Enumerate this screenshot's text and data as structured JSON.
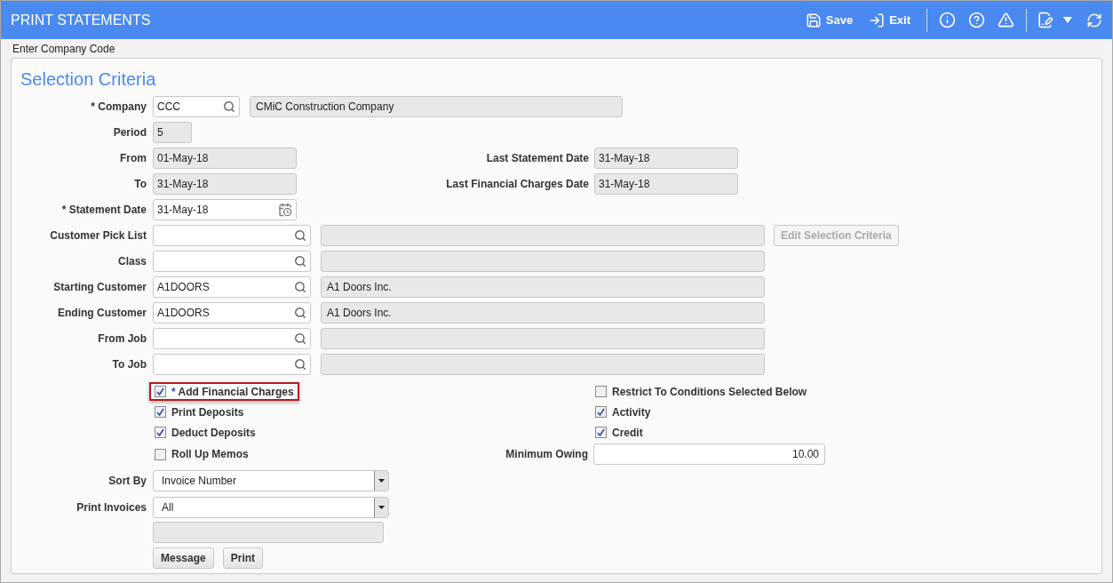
{
  "header": {
    "title": "PRINT STATEMENTS",
    "actions": [
      {
        "label": "Save",
        "kind": "save"
      },
      {
        "label": "Exit",
        "kind": "exit"
      }
    ]
  },
  "hint": "Enter Company Code",
  "section_title": "Selection Criteria",
  "rows": [
    {
      "label": "* Company",
      "field": {
        "kind": "code",
        "value": "CCC"
      },
      "description": "CMiC Construction Company"
    },
    {
      "label": "Period",
      "field": {
        "kind": "number",
        "value": "5"
      }
    },
    {
      "label": "From",
      "field": {
        "kind": "readonly",
        "value": "01-May-18"
      },
      "right": {
        "label": "Last Statement Date",
        "value": "31-May-18"
      }
    },
    {
      "label": "To",
      "field": {
        "kind": "readonly",
        "value": "31-May-18"
      },
      "right": {
        "label": "Last Financial Charges Date",
        "value": "31-May-18"
      }
    },
    {
      "label": "* Statement Date",
      "field": {
        "kind": "date",
        "value": "31-May-18"
      }
    },
    {
      "label": "Customer Pick List",
      "field": {
        "kind": "lookup"
      },
      "description": "",
      "button": {
        "label": "Edit Selection Criteria",
        "disabled": true
      }
    },
    {
      "label": "Class",
      "field": {
        "kind": "lookup"
      },
      "description": ""
    },
    {
      "label": "Starting Customer",
      "field": {
        "kind": "lookup",
        "value": "A1DOORS"
      },
      "description": "A1 Doors Inc."
    },
    {
      "label": "Ending Customer",
      "field": {
        "kind": "lookup",
        "value": "A1DOORS"
      },
      "description": "A1 Doors Inc."
    },
    {
      "label": "From Job",
      "field": {
        "kind": "lookup"
      },
      "description": ""
    },
    {
      "label": "To Job",
      "field": {
        "kind": "lookup"
      },
      "description": ""
    }
  ],
  "left_checkboxes": [
    {
      "marker": "*",
      "label": "Add Financial Charges",
      "checked": true,
      "highlighted": true
    },
    {
      "label": "Print Deposits",
      "checked": true,
      "highlighted": false
    },
    {
      "label": "Deduct Deposits",
      "checked": true,
      "highlighted": false
    },
    {
      "label": "Roll Up Memos",
      "checked": false,
      "highlighted": false
    }
  ],
  "right_checkboxes": [
    {
      "label": "Restrict To Conditions Selected Below",
      "checked": false
    },
    {
      "label": "Activity",
      "checked": true
    },
    {
      "label": "Credit",
      "checked": true
    }
  ],
  "minimum_owing": {
    "label": "Minimum Owing",
    "value": "10.00"
  },
  "selects": [
    {
      "label": "Sort By",
      "value": "Invoice Number"
    },
    {
      "label": "Print Invoices",
      "value": "All"
    }
  ],
  "buttons": [
    "Message",
    "Print"
  ]
}
